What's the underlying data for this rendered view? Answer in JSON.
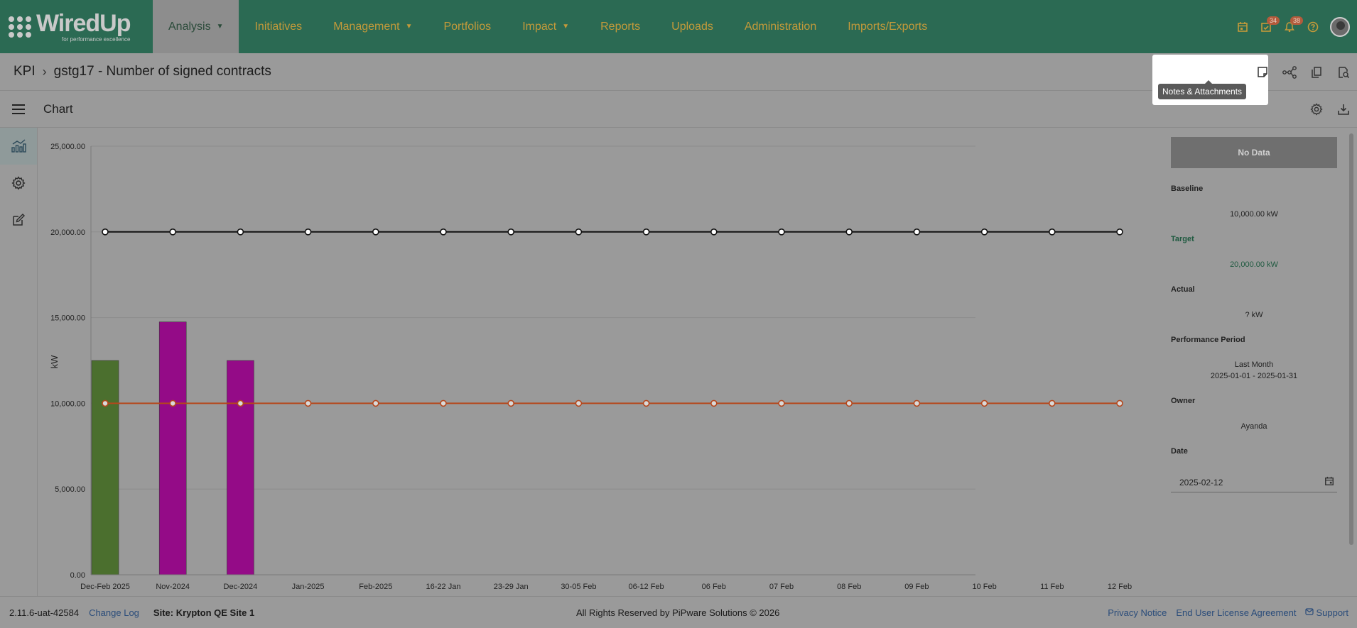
{
  "brand": {
    "name": "WiredUp",
    "tagline": "for performance excellence"
  },
  "nav": {
    "items": [
      {
        "label": "Analysis",
        "dropdown": true,
        "active": true
      },
      {
        "label": "Initiatives"
      },
      {
        "label": "Management",
        "dropdown": true
      },
      {
        "label": "Portfolios"
      },
      {
        "label": "Impact",
        "dropdown": true
      },
      {
        "label": "Reports"
      },
      {
        "label": "Uploads"
      },
      {
        "label": "Administration"
      },
      {
        "label": "Imports/Exports"
      }
    ],
    "icons": [
      {
        "name": "calendar-icon"
      },
      {
        "name": "tasks-icon",
        "badge": "34"
      },
      {
        "name": "bell-icon",
        "badge": "38"
      },
      {
        "name": "help-icon"
      }
    ]
  },
  "breadcrumb": {
    "root": "KPI",
    "title": "gstg17 - Number of signed contracts"
  },
  "header_tools": [
    "notes-icon",
    "network-icon",
    "copy-icon",
    "search-document-icon"
  ],
  "tooltip": "Notes & Attachments",
  "chart_section": {
    "title": "Chart"
  },
  "colors": {
    "nav_bg": "#2b6a53",
    "nav_text": "#c49a3a",
    "bar_green": "#4b6f2e",
    "bar_magenta": "#940b87",
    "target_line": "#111111",
    "baseline_line": "#b5471c",
    "target_text": "#1f5a40"
  },
  "chart_data": {
    "type": "bar",
    "ylabel": "kW",
    "ylim": [
      0,
      25000
    ],
    "yticks": [
      "0.00",
      "5,000.00",
      "10,000.00",
      "15,000.00",
      "20,000.00",
      "25,000.00"
    ],
    "categories": [
      "Dec-Feb 2025",
      "Nov-2024",
      "Dec-2024",
      "Jan-2025",
      "Feb-2025",
      "16-22 Jan",
      "23-29 Jan",
      "30-05 Feb",
      "06-12 Feb",
      "06 Feb",
      "07 Feb",
      "08 Feb",
      "09 Feb",
      "10 Feb",
      "11 Feb",
      "12 Feb"
    ],
    "bars": [
      {
        "category": "Dec-Feb 2025",
        "value": 12500,
        "color": "#4b6f2e"
      },
      {
        "category": "Nov-2024",
        "value": 14750,
        "color": "#940b87"
      },
      {
        "category": "Dec-2024",
        "value": 12500,
        "color": "#940b87"
      }
    ],
    "series": [
      {
        "values": [
          20000,
          20000,
          20000,
          20000,
          20000,
          20000,
          20000,
          20000,
          20000,
          20000,
          20000,
          20000,
          20000,
          20000,
          20000,
          20000
        ],
        "color": "#111111"
      },
      {
        "values": [
          10000,
          10000,
          10000,
          10000,
          10000,
          10000,
          10000,
          10000,
          10000,
          10000,
          10000,
          10000,
          10000,
          10000,
          10000,
          10000
        ],
        "color": "#b5471c"
      }
    ],
    "grid": true
  },
  "side_panel": {
    "status": "No Data",
    "baseline_label": "Baseline",
    "baseline_value": "10,000.00 kW",
    "target_label": "Target",
    "target_value": "20,000.00 kW",
    "actual_label": "Actual",
    "actual_value": "? kW",
    "period_label": "Performance Period",
    "period_name": "Last Month",
    "period_range": "2025-01-01 - 2025-01-31",
    "owner_label": "Owner",
    "owner_value": "Ayanda",
    "date_label": "Date",
    "date_value": "2025-02-12"
  },
  "footer": {
    "version": "2.11.6-uat-42584",
    "changelog": "Change Log",
    "site": "Site: Krypton QE Site 1",
    "copyright": "All Rights Reserved by PiPware Solutions © 2026",
    "privacy": "Privacy Notice",
    "eula": "End User License Agreement",
    "support": "Support"
  }
}
